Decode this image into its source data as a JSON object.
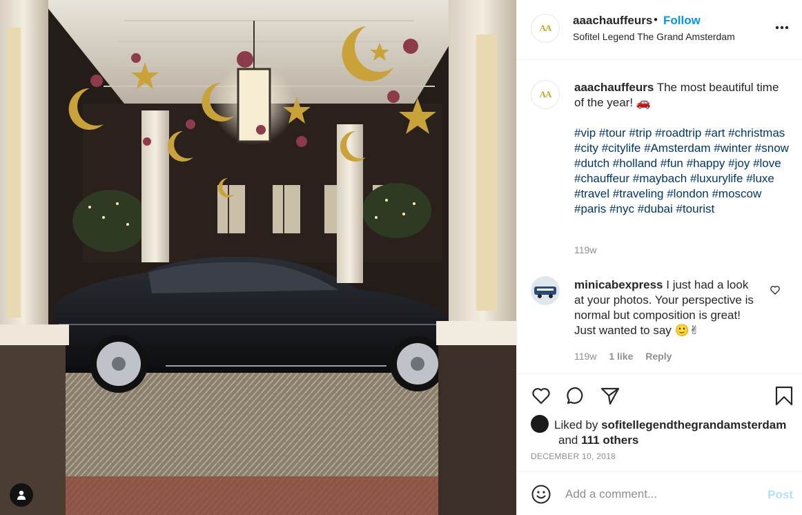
{
  "colors": {
    "accent": "#0095f6",
    "link": "#00376b",
    "muted": "#8e8e8e",
    "post_disabled": "#b2dffc"
  },
  "photo": {
    "alt_icon": "user-tag-icon"
  },
  "header": {
    "username": "aaachauffeurs",
    "dot": "•",
    "follow_label": "Follow",
    "location": "Sofitel Legend The Grand Amsterdam",
    "avatar_text": "AA",
    "more_icon": "more-horizontal-icon"
  },
  "caption": {
    "username": "aaachauffeurs",
    "text": "The most beautiful time of the year!",
    "emoji": "🚗",
    "hashtags": [
      "#vip",
      "#tour",
      "#trip",
      "#roadtrip",
      "#art",
      "#christmas",
      "#city",
      "#citylife",
      "#Amsterdam",
      "#winter",
      "#snow",
      "#dutch",
      "#holland",
      "#fun",
      "#happy",
      "#joy",
      "#love",
      "#chauffeur",
      "#maybach",
      "#luxurylife",
      "#luxe",
      "#travel",
      "#traveling",
      "#london",
      "#moscow",
      "#paris",
      "#nyc",
      "#dubai",
      "#tourist"
    ],
    "time": "119w"
  },
  "comment": {
    "username": "minicabexpress",
    "text": "I just had a look at your photos. Your perspective is normal but composition is great! Just wanted to say 🙂✌",
    "time": "119w",
    "likes": "1 like",
    "reply": "Reply"
  },
  "actions": {
    "liked_by_prefix": "Liked by",
    "liked_by_user": "sofitellegendthegrandamsterdam",
    "and": "and",
    "others": "111 others",
    "date": "DECEMBER 10, 2018"
  },
  "add_comment": {
    "placeholder": "Add a comment...",
    "post_label": "Post"
  }
}
